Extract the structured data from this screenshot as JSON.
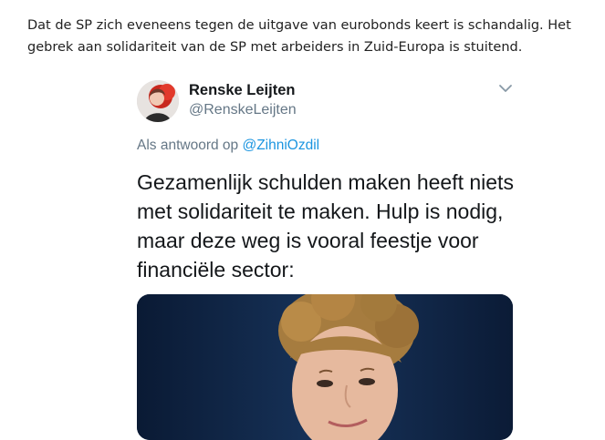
{
  "intro": {
    "text": "Dat de SP zich eveneens tegen de uitgave van eurobonds keert is schandalig. Het gebrek aan solidariteit van de SP met arbeiders in Zuid-Europa is stuitend."
  },
  "tweet": {
    "author_name": "Renske Leijten",
    "author_handle": "@RenskeLeijten",
    "reply_prefix": "Als antwoord op",
    "reply_handle": "@ZihniOzdil",
    "text": "Gezamenlijk schulden maken heeft niets met solidariteit te maken. Hulp is nodig, maar deze weg is vooral feestje voor financiële sector:",
    "menu_icon": "chevron-down-icon"
  },
  "colors": {
    "link": "#1b95e0",
    "secondary_text": "#657786",
    "primary_text": "#14171a"
  }
}
